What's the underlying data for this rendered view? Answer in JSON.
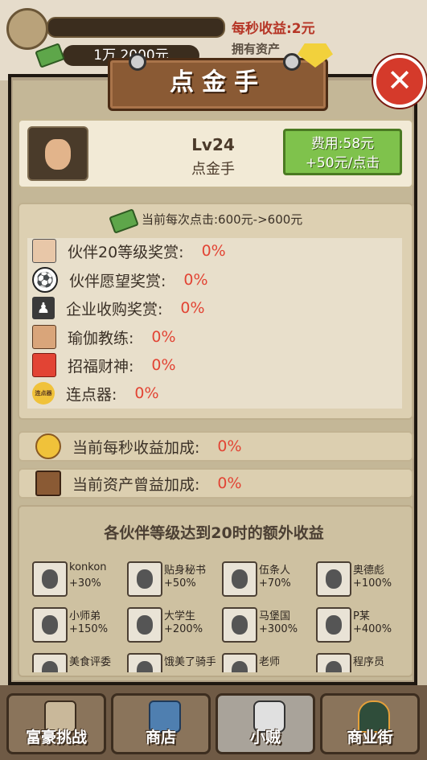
{
  "hud": {
    "income_label": "每秒收益:2元",
    "asset_value": "1万 2000元",
    "asset_label": "拥有资产"
  },
  "dialog": {
    "title": "点金手",
    "close": "✕"
  },
  "card": {
    "level": "Lv24",
    "name": "点金手",
    "cost_line1": "费用:58元",
    "cost_line2": "+50元/点击"
  },
  "stats": {
    "header": "当前每次点击:600元->600元",
    "rows": [
      {
        "label": "伙伴20等级奖赏:",
        "value": "0%"
      },
      {
        "label": "伙伴愿望奖赏:",
        "value": "0%"
      },
      {
        "label": "企业收购奖赏:",
        "value": "0%"
      },
      {
        "label": "瑜伽教练:",
        "value": "0%"
      },
      {
        "label": "招福财神:",
        "value": "0%"
      },
      {
        "label": "连点器:",
        "value": "0%"
      }
    ],
    "icon_labels": {
      "clicker": "连点器"
    }
  },
  "bonuses": [
    {
      "label": "当前每秒收益加成:",
      "value": "0%"
    },
    {
      "label": "当前资产曾益加成:",
      "value": "0%"
    }
  ],
  "partners": {
    "title": "各伙伴等级达到20时的额外收益",
    "items": [
      {
        "name": "konkon",
        "bonus": "+30%"
      },
      {
        "name": "贴身秘书",
        "bonus": "+50%"
      },
      {
        "name": "伍条人",
        "bonus": "+70%"
      },
      {
        "name": "奥德彪",
        "bonus": "+100%"
      },
      {
        "name": "小师弟",
        "bonus": "+150%"
      },
      {
        "name": "大学生",
        "bonus": "+200%"
      },
      {
        "name": "马堡国",
        "bonus": "+300%"
      },
      {
        "name": "P某",
        "bonus": "+400%"
      },
      {
        "name": "美食评委",
        "bonus": ""
      },
      {
        "name": "饿美了骑手",
        "bonus": ""
      },
      {
        "name": "老师",
        "bonus": ""
      },
      {
        "name": "程序员",
        "bonus": ""
      }
    ]
  },
  "nav": [
    {
      "label": "富豪挑战"
    },
    {
      "label": "商店"
    },
    {
      "label": "小贼"
    },
    {
      "label": "商业街"
    }
  ],
  "colors": {
    "accent_red": "#e24434",
    "button_green": "#7fc24c",
    "close_red": "#d53a2b"
  }
}
